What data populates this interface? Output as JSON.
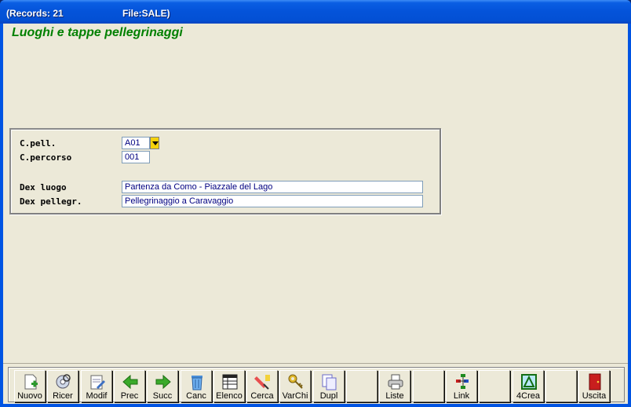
{
  "window": {
    "records_label": "(Records: 21",
    "file_label": "File:SALE)"
  },
  "form": {
    "heading": "Luoghi e tappe pellegrinaggi",
    "fields": {
      "cpell_label": "C.pell.",
      "cpell_value": "A01",
      "cpercorso_label": "C.percorso",
      "cpercorso_value": "001",
      "dexluogo_label": "Dex luogo",
      "dexluogo_value": "Partenza da Como - Piazzale del Lago",
      "dexpellegr_label": "Dex pellegr.",
      "dexpellegr_value": "Pellegrinaggio a Caravaggio"
    }
  },
  "toolbar": {
    "buttons": [
      {
        "label": "Nuovo",
        "icon": "new-icon"
      },
      {
        "label": "Ricer",
        "icon": "search-disk-icon"
      },
      {
        "label": "Modif",
        "icon": "edit-icon"
      },
      {
        "label": "Prec",
        "icon": "arrow-left-icon"
      },
      {
        "label": "Succ",
        "icon": "arrow-right-icon"
      },
      {
        "label": "Canc",
        "icon": "trash-icon"
      },
      {
        "label": "Elenco",
        "icon": "list-grid-icon"
      },
      {
        "label": "Cerca",
        "icon": "find-icon"
      },
      {
        "label": "VarChi",
        "icon": "keys-icon"
      },
      {
        "label": "Dupl",
        "icon": "duplicate-icon"
      },
      {
        "label": "",
        "icon": ""
      },
      {
        "label": "Liste",
        "icon": "printer-icon"
      },
      {
        "label": "",
        "icon": ""
      },
      {
        "label": "Link",
        "icon": "link-tree-icon"
      },
      {
        "label": "",
        "icon": ""
      },
      {
        "label": "4Crea",
        "icon": "create-icon"
      },
      {
        "label": "",
        "icon": ""
      },
      {
        "label": "Uscita",
        "icon": "exit-door-icon"
      }
    ]
  },
  "colors": {
    "titlebar": "#0453d9",
    "client_bg": "#ece9d8",
    "heading": "#008000",
    "field_text": "#000080"
  }
}
